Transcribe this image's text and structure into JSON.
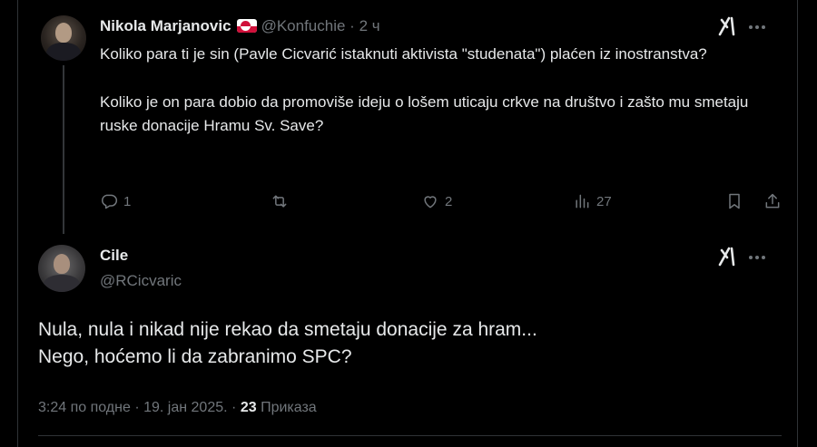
{
  "reply_to": {
    "author_name": "Nikola Marjanovic",
    "flag_icon": "greenland-flag-icon",
    "handle": "@Konfuchie",
    "separator": "·",
    "time_ago": "2 ч",
    "paragraphs": [
      "Koliko para ti je sin (Pavle Cicvarić istaknuti aktivista \"studenata\") plaćen iz inostranstva?",
      "Koliko je on para dobio da promoviše ideju o lošem uticaju crkve na društvo i zašto mu smetaju ruske donacije Hramu Sv. Save?"
    ],
    "actions": {
      "replies": "1",
      "retweets": "",
      "likes": "2",
      "views": "27"
    }
  },
  "tweet": {
    "author_name": "Cile",
    "handle": "@RCicvaric",
    "lines": [
      "Nula, nula i nikad nije rekao da smetaju donacije za hram...",
      "Nego, hoćemo li da zabranimo SPC?"
    ],
    "time": "3:24 по подне",
    "date": "19. јан 2025.",
    "dot": "·",
    "views_count": "23",
    "views_label": "Приказа"
  },
  "colors": {
    "background": "#000000",
    "text": "#e7e9ea",
    "muted": "#71767b",
    "divider": "#2f3336",
    "flag_red": "#d0103a"
  }
}
